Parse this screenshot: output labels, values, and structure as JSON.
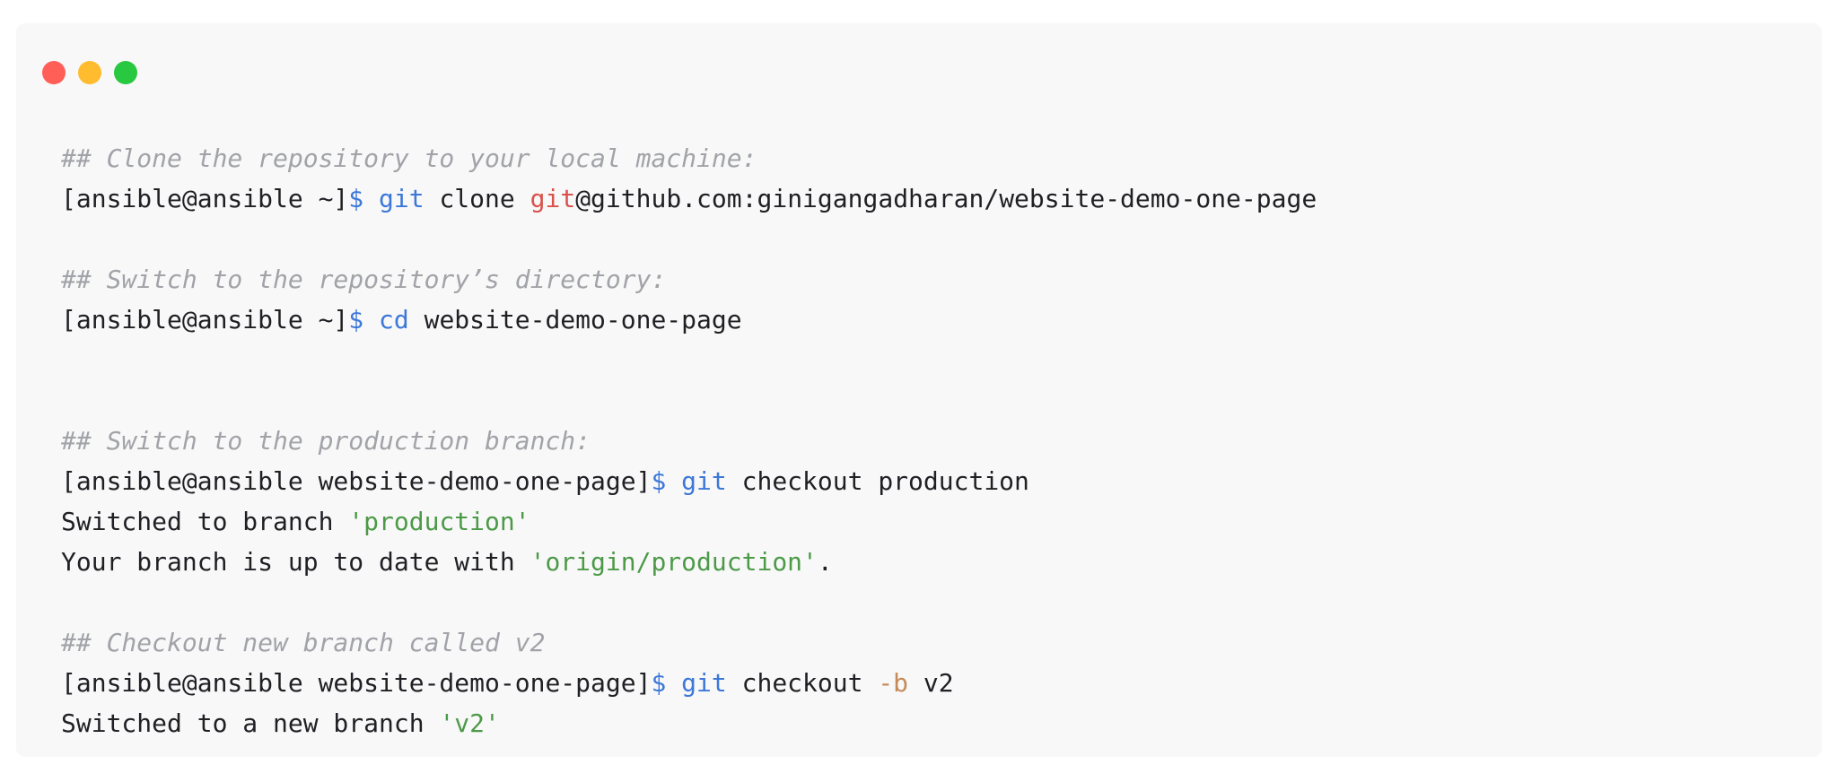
{
  "colors": {
    "background": "#f8f8f8",
    "text": "#1f1f24",
    "comment": "#a2a3a8",
    "command": "#3d78d8",
    "git_highlight": "#d9524c",
    "string": "#4c9a48",
    "flag": "#c68a58",
    "close": "#ff5f57",
    "minimize": "#febc2e",
    "zoom": "#28c840"
  },
  "window_controls": [
    {
      "name": "close",
      "color": "#ff5f57"
    },
    {
      "name": "minimize",
      "color": "#febc2e"
    },
    {
      "name": "zoom",
      "color": "#28c840"
    }
  ],
  "terminal": {
    "lines": [
      {
        "type": "comment",
        "segments": [
          {
            "text": "## Clone the repository to your local machine:",
            "style": "comment"
          }
        ]
      },
      {
        "type": "command",
        "segments": [
          {
            "text": "[ansible@ansible ~]",
            "style": "text"
          },
          {
            "text": "$ ",
            "style": "command"
          },
          {
            "text": "git",
            "style": "command"
          },
          {
            "text": " clone ",
            "style": "text"
          },
          {
            "text": "git",
            "style": "git_highlight"
          },
          {
            "text": "@github.com:ginigangadharan/website-demo-one-page",
            "style": "text"
          }
        ]
      },
      {
        "type": "blank",
        "segments": []
      },
      {
        "type": "comment",
        "segments": [
          {
            "text": "## Switch to the repository’s directory:",
            "style": "comment"
          }
        ]
      },
      {
        "type": "command",
        "segments": [
          {
            "text": "[ansible@ansible ~]",
            "style": "text"
          },
          {
            "text": "$ ",
            "style": "command"
          },
          {
            "text": "cd",
            "style": "command"
          },
          {
            "text": " website-demo-one-page",
            "style": "text"
          }
        ]
      },
      {
        "type": "blank",
        "segments": []
      },
      {
        "type": "blank",
        "segments": []
      },
      {
        "type": "comment",
        "segments": [
          {
            "text": "## Switch to the production branch:",
            "style": "comment"
          }
        ]
      },
      {
        "type": "command",
        "segments": [
          {
            "text": "[ansible@ansible website-demo-one-page]",
            "style": "text"
          },
          {
            "text": "$ ",
            "style": "command"
          },
          {
            "text": "git",
            "style": "command"
          },
          {
            "text": " checkout production",
            "style": "text"
          }
        ]
      },
      {
        "type": "output",
        "segments": [
          {
            "text": "Switched to branch ",
            "style": "text"
          },
          {
            "text": "'production'",
            "style": "string"
          }
        ]
      },
      {
        "type": "output",
        "segments": [
          {
            "text": "Your branch is up to date with ",
            "style": "text"
          },
          {
            "text": "'origin/production'",
            "style": "string"
          },
          {
            "text": ".",
            "style": "text"
          }
        ]
      },
      {
        "type": "blank",
        "segments": []
      },
      {
        "type": "comment",
        "segments": [
          {
            "text": "## Checkout new branch called v2",
            "style": "comment"
          }
        ]
      },
      {
        "type": "command",
        "segments": [
          {
            "text": "[ansible@ansible website-demo-one-page]",
            "style": "text"
          },
          {
            "text": "$ ",
            "style": "command"
          },
          {
            "text": "git",
            "style": "command"
          },
          {
            "text": " checkout ",
            "style": "text"
          },
          {
            "text": "-b",
            "style": "flag"
          },
          {
            "text": " v2",
            "style": "text"
          }
        ]
      },
      {
        "type": "output",
        "segments": [
          {
            "text": "Switched to a new branch ",
            "style": "text"
          },
          {
            "text": "'v2'",
            "style": "string"
          }
        ]
      }
    ]
  }
}
